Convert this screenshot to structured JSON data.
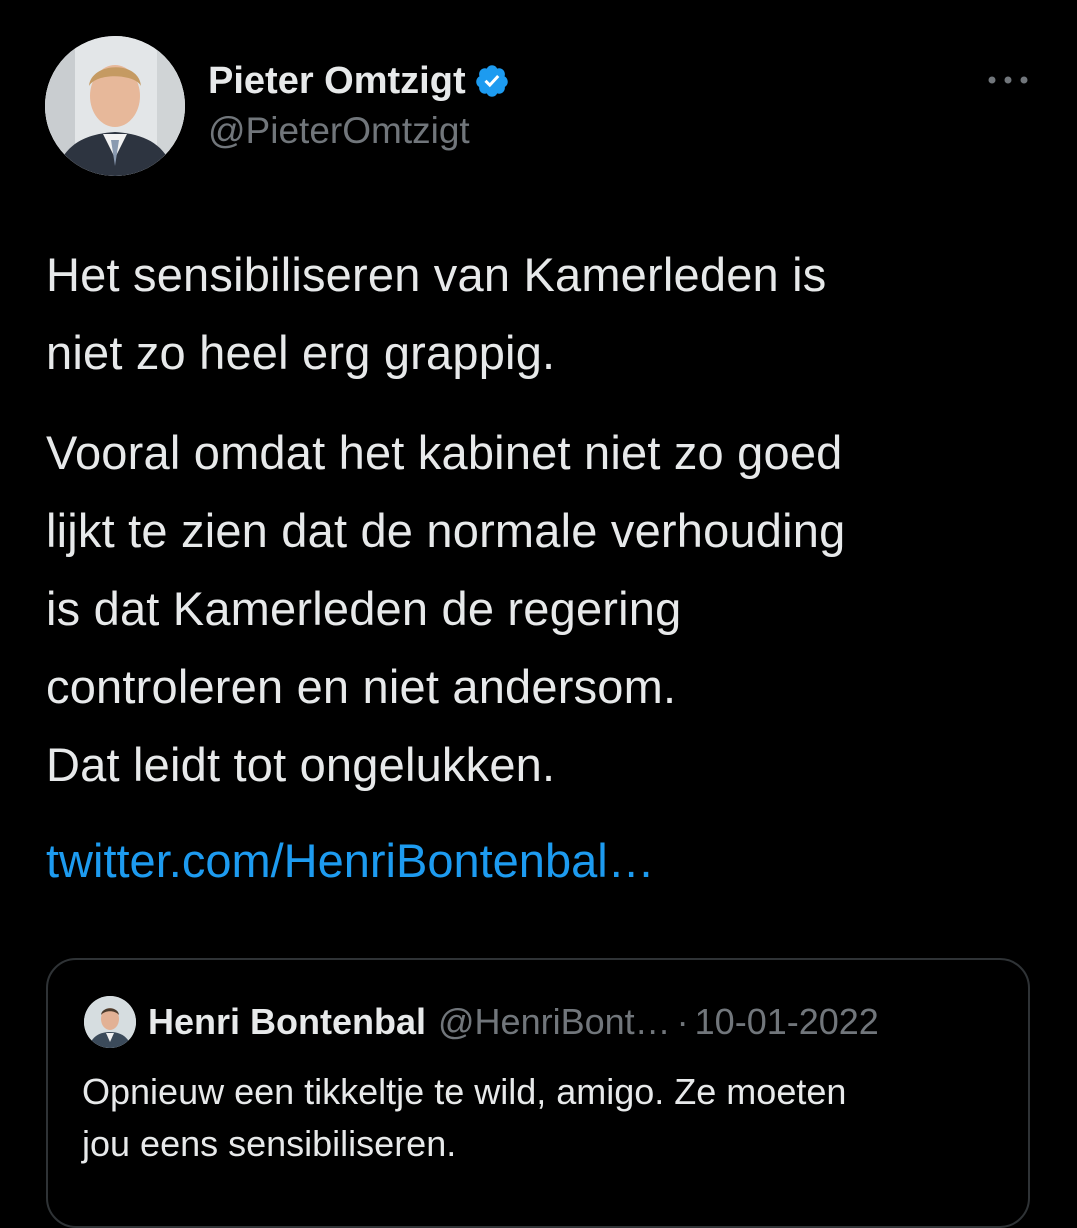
{
  "tweet": {
    "author": {
      "display_name": "Pieter Omtzigt",
      "handle": "@PieterOmtzigt",
      "verified": true
    },
    "more_icon": "more-horizontal-icon",
    "body": {
      "paragraph1": [
        "Het sensibiliseren van Kamerleden is",
        "niet zo heel erg grappig."
      ],
      "paragraph2": [
        "Vooral omdat het kabinet niet zo goed",
        "lijkt te zien dat de normale verhouding",
        "is dat Kamerleden de regering",
        "controleren en niet andersom.",
        "Dat leidt tot ongelukken."
      ]
    },
    "link_text": "twitter.com/HenriBontenbal…",
    "quoted": {
      "display_name": "Henri Bontenbal",
      "handle": "@HenriBont…",
      "separator": "·",
      "date": "10-01-2022",
      "text_lines": [
        "Opnieuw een tikkeltje te wild, amigo. Ze moeten",
        "jou eens sensibiliseren."
      ]
    }
  },
  "colors": {
    "background": "#000000",
    "text": "#e7e9ea",
    "secondary": "#71767b",
    "link": "#1d9bf0",
    "verified": "#1d9bf0",
    "border": "#2f3336"
  }
}
